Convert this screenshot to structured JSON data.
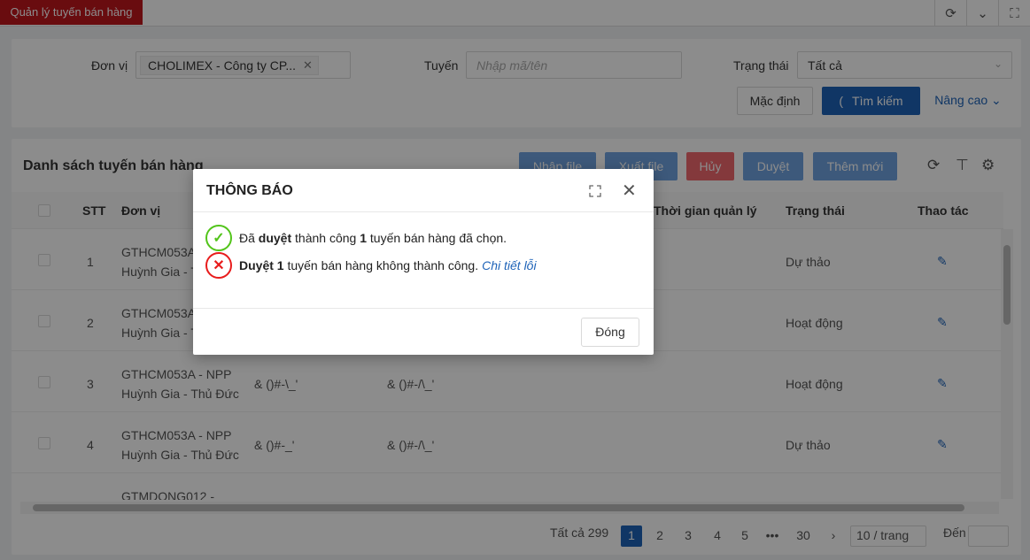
{
  "app": {
    "tab_title": "Quản lý tuyến bán hàng"
  },
  "topbar": {
    "icons": [
      "refresh-icon",
      "chevron-down-icon",
      "fullscreen-icon"
    ]
  },
  "filter": {
    "unit_label": "Đơn vị",
    "unit_tag": "CHOLIMEX - Công ty CP...",
    "route_label": "Tuyến",
    "route_placeholder": "Nhập mã/tên",
    "status_label": "Trạng thái",
    "status_value": "Tất cả",
    "default_button": "Mặc định",
    "search_button": "Tìm kiếm",
    "advanced_link": "Nâng cao"
  },
  "list": {
    "title": "Danh sách tuyến bán hàng",
    "buttons": {
      "import": "Nhập file",
      "export": "Xuất file",
      "cancel": "Hủy",
      "approve": "Duyệt",
      "add": "Thêm mới"
    },
    "columns": {
      "stt": "STT",
      "unit": "Đơn vị",
      "mgmt_time": "Thời gian quản lý",
      "status": "Trạng thái",
      "actions": "Thao tác"
    },
    "rows": [
      {
        "stt": "1",
        "unit_line1": "GTHCM053A",
        "unit_line2": "Huỳnh Gia - T",
        "code": "",
        "name": "",
        "status": "Dự thảo"
      },
      {
        "stt": "2",
        "unit_line1": "GTHCM053A",
        "unit_line2": "Huỳnh Gia - T",
        "code": "",
        "name": "",
        "status": "Hoạt động"
      },
      {
        "stt": "3",
        "unit_line1": "GTHCM053A - NPP",
        "unit_line2": "Huỳnh Gia - Thủ Đức",
        "code": "& ()#-\\_'",
        "name": "& ()#-/\\_'",
        "status": "Hoạt động"
      },
      {
        "stt": "4",
        "unit_line1": "GTHCM053A - NPP",
        "unit_line2": "Huỳnh Gia - Thủ Đức",
        "code": "& ()#-_'",
        "name": "& ()#-/\\_'",
        "status": "Dự thảo"
      },
      {
        "stt": "",
        "unit_line1": "GTMDONG012 -",
        "unit_line2": "",
        "code": "",
        "name": "",
        "status": ""
      }
    ]
  },
  "pagination": {
    "total": "Tất cả 299",
    "pages": [
      "1",
      "2",
      "3",
      "4",
      "5"
    ],
    "ellipsis": "•••",
    "last": "30",
    "next": "›",
    "page_size": "10 / trang",
    "goto": "Đến"
  },
  "modal": {
    "title": "THÔNG BÁO",
    "success_pre": "Đã",
    "success_bold1": "duyệt",
    "success_mid": "thành công",
    "success_bold2": "1",
    "success_post": "tuyến bán hàng đã chọn.",
    "fail_bold": "Duyệt 1",
    "fail_post": "tuyến bán hàng không thành công.",
    "fail_link": "Chi tiết lỗi",
    "close_button": "Đóng"
  },
  "colors": {
    "brand": "#c0161d",
    "primary": "#1e63b8",
    "success": "#52c41a",
    "error": "#e81c1c"
  }
}
